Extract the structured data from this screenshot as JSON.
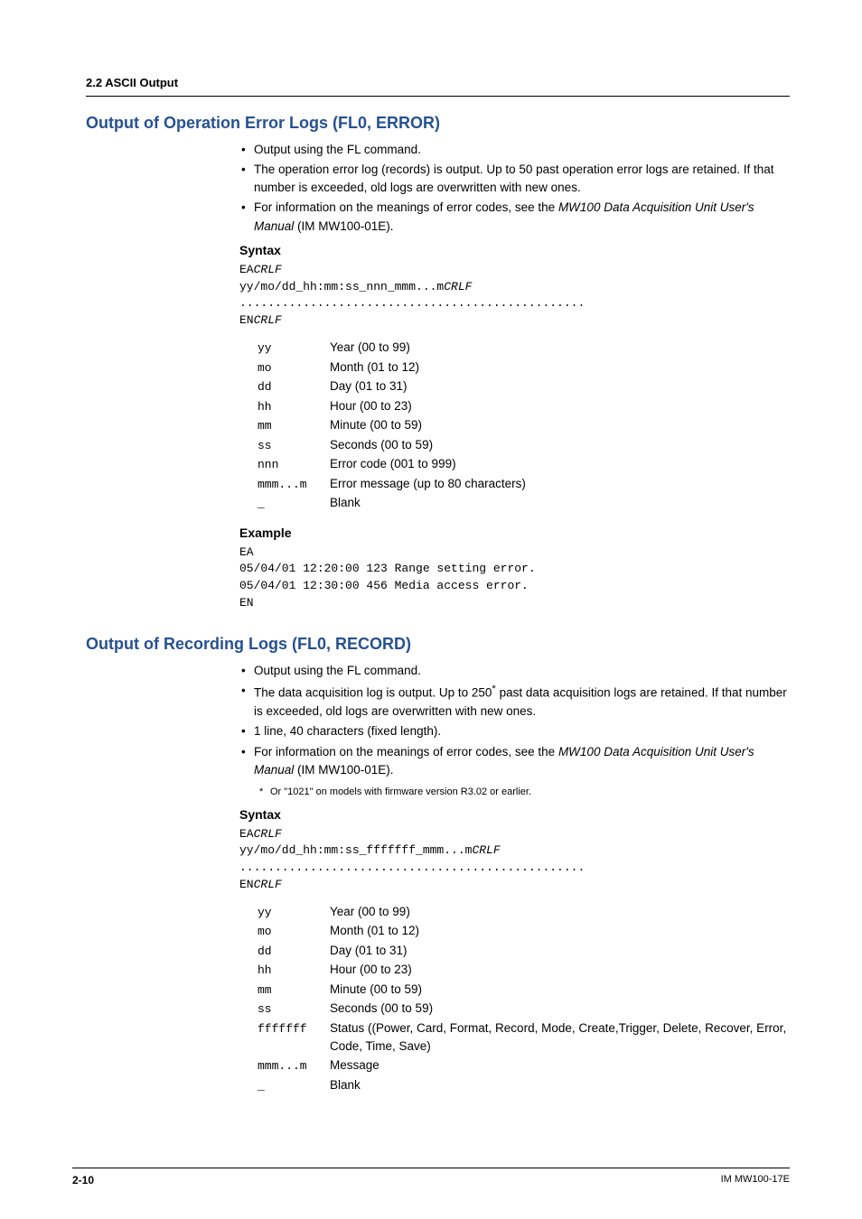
{
  "header": "2.2  ASCII Output",
  "section1": {
    "title": "Output of Operation Error Logs (FL0, ERROR)",
    "bullets": [
      "Output using the FL command.",
      "The operation error log (records) is output. Up to 50 past operation error logs are retained. If that number is exceeded, old logs are overwritten with new ones.",
      "For information on the meanings of error codes, see the <i>MW100 Data Acquisition Unit User's Manual</i> (IM MW100-01E)."
    ],
    "syntax_label": "Syntax",
    "syntax": "EA<i>CRLF</i>\nyy/mo/dd_hh:mm:ss_nnn_mmm...m<i>CRLF</i>\n.................................................\nEN<i>CRLF</i>",
    "defs": [
      {
        "k": "yy",
        "v": "Year (00 to 99)"
      },
      {
        "k": "mo",
        "v": "Month (01 to 12)"
      },
      {
        "k": "dd",
        "v": "Day (01 to 31)"
      },
      {
        "k": "hh",
        "v": "Hour (00 to 23)"
      },
      {
        "k": "mm",
        "v": "Minute (00 to 59)"
      },
      {
        "k": "ss",
        "v": "Seconds (00 to 59)"
      },
      {
        "k": "nnn",
        "v": "Error code (001 to 999)"
      },
      {
        "k": "mmm...m",
        "v": "Error message (up to 80 characters)"
      },
      {
        "k": "_",
        "v": "Blank"
      }
    ],
    "example_label": "Example",
    "example": "EA\n05/04/01 12:20:00 123 Range setting error.\n05/04/01 12:30:00 456 Media access error.\nEN"
  },
  "section2": {
    "title": "Output of Recording Logs (FL0, RECORD)",
    "bullets": [
      "Output using the FL command.",
      "The data acquisition log is output. Up to 250<sup>*</sup> past data acquisition logs are retained. If that number is exceeded, old logs are overwritten with new ones.",
      "1 line, 40 characters (fixed length).",
      "For information on the meanings of error codes, see the <i>MW100 Data Acquisition Unit User's Manual</i> (IM MW100-01E)."
    ],
    "footnote": "Or \"1021\" on models with firmware version R3.02 or earlier.",
    "syntax_label": "Syntax",
    "syntax": "EA<i>CRLF</i>\nyy/mo/dd_hh:mm:ss_fffffff_mmm...m<i>CRLF</i>\n.................................................\nEN<i>CRLF</i>",
    "defs": [
      {
        "k": "yy",
        "v": "Year (00 to 99)"
      },
      {
        "k": "mo",
        "v": "Month (01 to 12)"
      },
      {
        "k": "dd",
        "v": "Day (01 to 31)"
      },
      {
        "k": "hh",
        "v": "Hour (00 to 23)"
      },
      {
        "k": "mm",
        "v": "Minute (00 to 59)"
      },
      {
        "k": "ss",
        "v": "Seconds (00 to 59)"
      },
      {
        "k": "fffffff",
        "v": "Status ((Power, Card, Format, Record, Mode, Create,Trigger, Delete, Recover, Error, Code, Time, Save)"
      },
      {
        "k": "mmm...m",
        "v": "Message"
      },
      {
        "k": "_",
        "v": "Blank"
      }
    ]
  },
  "footer": {
    "page": "2-10",
    "doc": "IM MW100-17E"
  }
}
